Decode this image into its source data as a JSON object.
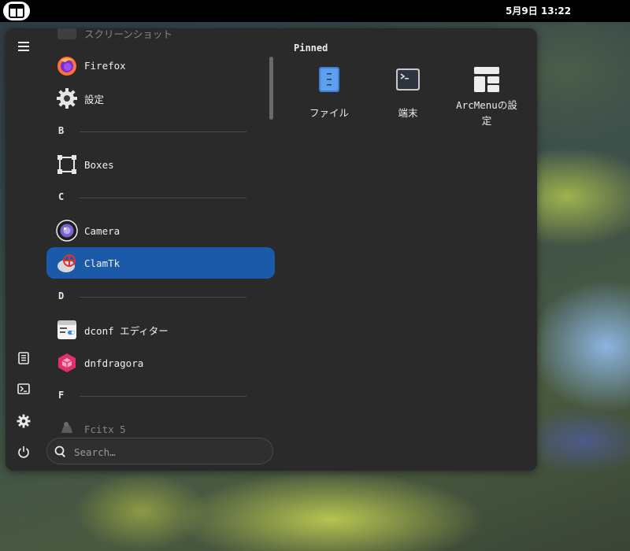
{
  "topbar": {
    "clock": "5月9日 13:22"
  },
  "side_rail": {
    "items": [
      {
        "icon": "hamburger-menu-icon"
      },
      {
        "icon": "document-icon"
      },
      {
        "icon": "terminal-icon"
      },
      {
        "icon": "gear-icon"
      },
      {
        "icon": "power-icon"
      }
    ]
  },
  "app_list": {
    "top_partial_label": "スクリーンショット",
    "items": [
      {
        "label": "Firefox",
        "icon": "firefox-icon"
      },
      {
        "label": "設定",
        "icon": "settings-gear-icon"
      },
      {
        "section": "B"
      },
      {
        "label": "Boxes",
        "icon": "boxes-icon"
      },
      {
        "section": "C"
      },
      {
        "label": "Camera",
        "icon": "camera-icon"
      },
      {
        "label": "ClamTk",
        "icon": "clamtk-icon",
        "selected": true
      },
      {
        "section": "D"
      },
      {
        "label": "dconf エディター",
        "icon": "dconf-editor-icon"
      },
      {
        "label": "dnfdragora",
        "icon": "dnfdragora-icon"
      },
      {
        "section": "F"
      },
      {
        "label": "Fcitx 5",
        "icon": "fcitx-icon"
      }
    ]
  },
  "search": {
    "placeholder": "Search…",
    "value": ""
  },
  "pinned": {
    "title": "Pinned",
    "items": [
      {
        "label": "ファイル",
        "icon": "files-icon"
      },
      {
        "label": "端末",
        "icon": "terminal-app-icon"
      },
      {
        "label_line1": "ArcMenuの設",
        "label_line2": "定",
        "icon": "arcmenu-settings-icon"
      }
    ]
  },
  "colors": {
    "menu_bg": "#2a2a2a",
    "selected_bg": "#1b5aa8",
    "topbar_bg": "#000000"
  }
}
